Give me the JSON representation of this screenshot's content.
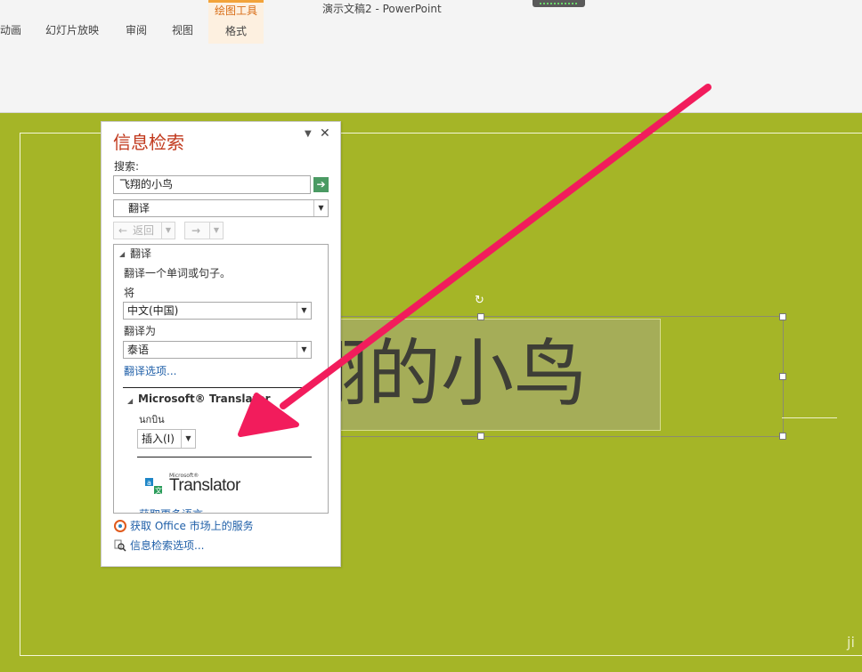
{
  "window": {
    "title": "演示文稿2 - PowerPoint"
  },
  "ribbon": {
    "tabs": [
      "动画",
      "幻灯片放映",
      "审阅",
      "视图"
    ],
    "context_group_label": "绘图工具",
    "context_tab": "格式"
  },
  "slide": {
    "title_text": "翔的小鸟",
    "background_color": "#a5b527",
    "watermark": "ji"
  },
  "research_pane": {
    "title": "信息检索",
    "search_label": "搜索:",
    "search_value": "飞翔的小鸟",
    "service_select": "翻译",
    "back_label": "返回",
    "forward_label": "→",
    "translate_section": {
      "heading": "翻译",
      "description": "翻译一个单词或句子。",
      "from_label": "将",
      "from_value": "中文(中国)",
      "to_label": "翻译为",
      "to_value": "泰语",
      "options_link": "翻译选项..."
    },
    "ms_translator": {
      "heading": "Microsoft® Translator",
      "result": "นกบิน",
      "insert_button": "插入(I)",
      "logo_small": "Microsoft®",
      "logo_word": "Translator",
      "more_languages": "获取更多语言"
    },
    "footer": {
      "office_store": "获取 Office 市场上的服务",
      "research_options": "信息检索选项..."
    }
  },
  "annotation": {
    "arrow_color": "#f21c5c"
  }
}
